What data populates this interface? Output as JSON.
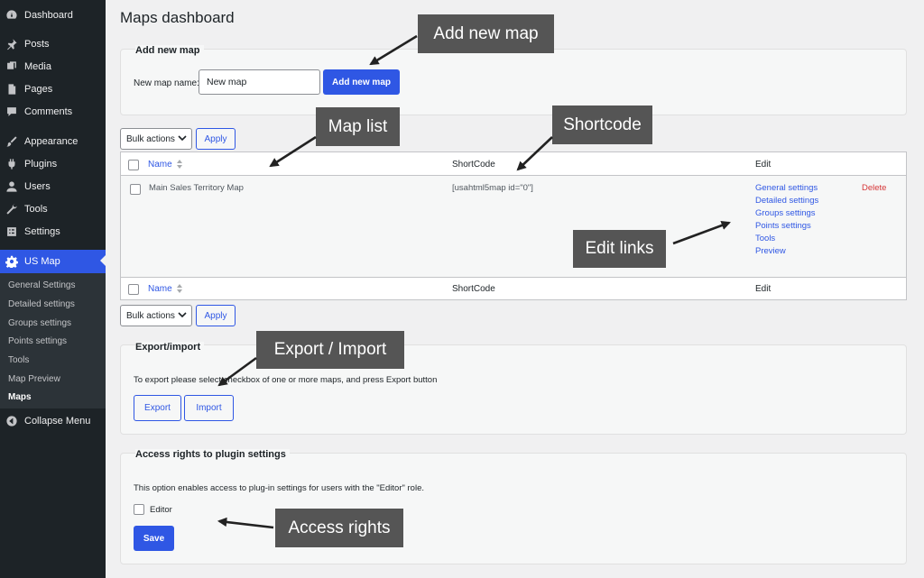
{
  "sidebar": {
    "items": [
      {
        "label": "Dashboard",
        "icon": "dashboard-icon"
      },
      {
        "label": "Posts",
        "icon": "pin-icon"
      },
      {
        "label": "Media",
        "icon": "media-icon"
      },
      {
        "label": "Pages",
        "icon": "pages-icon"
      },
      {
        "label": "Comments",
        "icon": "comment-icon"
      },
      {
        "label": "Appearance",
        "icon": "brush-icon"
      },
      {
        "label": "Plugins",
        "icon": "plugin-icon"
      },
      {
        "label": "Users",
        "icon": "user-icon"
      },
      {
        "label": "Tools",
        "icon": "wrench-icon"
      },
      {
        "label": "Settings",
        "icon": "settings-icon"
      },
      {
        "label": "US Map",
        "icon": "gear-icon",
        "active": true
      }
    ],
    "submenu": [
      "General Settings",
      "Detailed settings",
      "Groups settings",
      "Points settings",
      "Tools",
      "Map Preview",
      "Maps"
    ],
    "current_submenu": "Maps",
    "collapse_label": "Collapse Menu",
    "collapse_icon": "collapse-icon"
  },
  "page": {
    "title": "Maps dashboard"
  },
  "add_map": {
    "title": "Add new map",
    "name_label": "New map name:",
    "name_value": "New map",
    "button": "Add new map"
  },
  "bulk": {
    "select_value": "Bulk actions",
    "apply": "Apply"
  },
  "table": {
    "columns": [
      "Name",
      "ShortCode",
      "Edit"
    ],
    "rows": [
      {
        "name": "Main Sales Territory Map",
        "shortcode": "[usahtml5map id=\"0\"]",
        "edit_links": [
          "General settings",
          "Detailed settings",
          "Groups settings",
          "Points settings",
          "Tools",
          "Preview"
        ],
        "delete": "Delete"
      }
    ]
  },
  "export_import": {
    "title": "Export/import",
    "description": "To export please select checkbox of one or more maps, and press Export button",
    "export_button": "Export",
    "import_button": "Import"
  },
  "access": {
    "title": "Access rights to plugin settings",
    "description": "This option enables access to plug-in settings for users with the \"Editor\" role.",
    "editor_label": "Editor",
    "editor_checked": false,
    "save_button": "Save"
  },
  "annotations": {
    "add_new_map": "Add new map",
    "map_list": "Map list",
    "shortcode": "Shortcode",
    "edit_links": "Edit links",
    "export_import": "Export / Import",
    "access_rights": "Access rights"
  },
  "colors": {
    "sidebar_bg": "#1d2327",
    "accent": "#2f57e4",
    "delete": "#d63638",
    "callout_bg": "#555555"
  }
}
